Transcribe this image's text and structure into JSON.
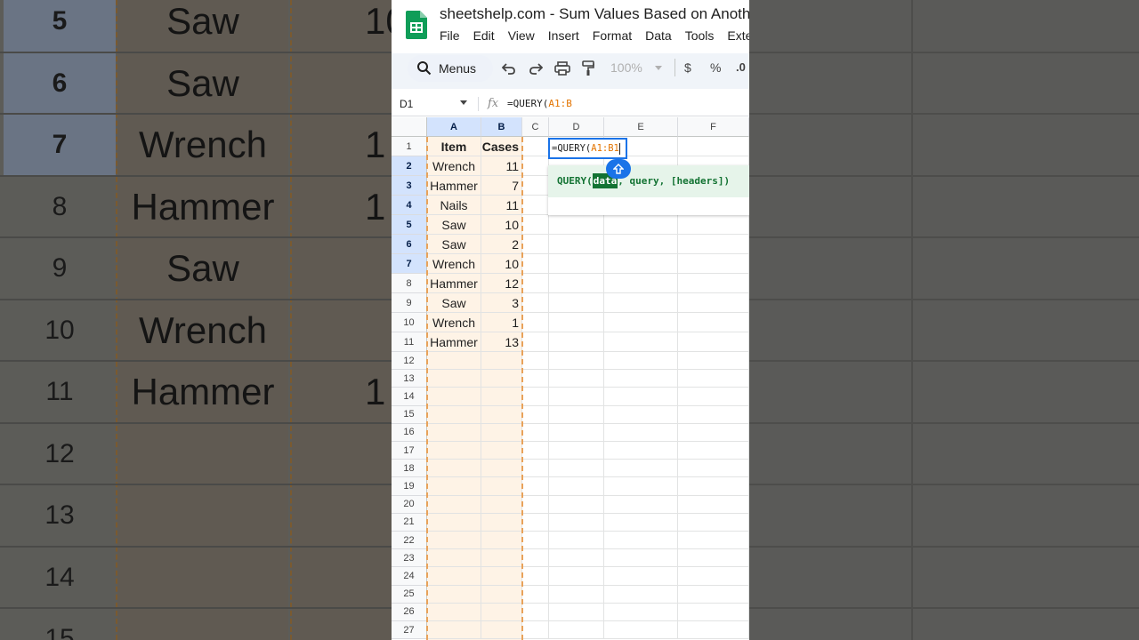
{
  "background": {
    "rows": [
      {
        "num": "5",
        "item": "Saw",
        "cases": "10",
        "selected": true
      },
      {
        "num": "6",
        "item": "Saw",
        "cases": "",
        "selected": true
      },
      {
        "num": "7",
        "item": "Wrench",
        "cases": "1",
        "selected": true
      },
      {
        "num": "8",
        "item": "Hammer",
        "cases": "1",
        "selected": false
      },
      {
        "num": "9",
        "item": "Saw",
        "cases": "",
        "selected": false
      },
      {
        "num": "10",
        "item": "Wrench",
        "cases": "",
        "selected": false
      },
      {
        "num": "11",
        "item": "Hammer",
        "cases": "1",
        "selected": false
      },
      {
        "num": "12",
        "item": "",
        "cases": "",
        "selected": false
      },
      {
        "num": "13",
        "item": "",
        "cases": "",
        "selected": false
      },
      {
        "num": "14",
        "item": "",
        "cases": "",
        "selected": false
      },
      {
        "num": "15",
        "item": "",
        "cases": "",
        "selected": false
      }
    ]
  },
  "app": {
    "doc_title": "sheetshelp.com - Sum Values Based on Anoth",
    "menu": [
      "File",
      "Edit",
      "View",
      "Insert",
      "Format",
      "Data",
      "Tools",
      "Exte"
    ]
  },
  "toolbar": {
    "menus_label": "Menus",
    "zoom": "100%",
    "currency": "$",
    "percent": "%",
    "decimal": ".0"
  },
  "formula_bar": {
    "name_box": "D1",
    "fx": "fx",
    "formula_prefix": "=QUERY(",
    "formula_range": "A1:B"
  },
  "sheet": {
    "columns": [
      "A",
      "B",
      "C",
      "D",
      "E",
      "F"
    ],
    "selected_columns": [
      "A",
      "B"
    ],
    "rows": [
      {
        "num": "1",
        "a": "Item",
        "b": "Cases",
        "selected": false
      },
      {
        "num": "2",
        "a": "Wrench",
        "b": "11",
        "selected": true
      },
      {
        "num": "3",
        "a": "Hammer",
        "b": "7",
        "selected": true
      },
      {
        "num": "4",
        "a": "Nails",
        "b": "11",
        "selected": true
      },
      {
        "num": "5",
        "a": "Saw",
        "b": "10",
        "selected": true
      },
      {
        "num": "6",
        "a": "Saw",
        "b": "2",
        "selected": true
      },
      {
        "num": "7",
        "a": "Wrench",
        "b": "10",
        "selected": true
      },
      {
        "num": "8",
        "a": "Hammer",
        "b": "12",
        "selected": false
      },
      {
        "num": "9",
        "a": "Saw",
        "b": "3",
        "selected": false
      },
      {
        "num": "10",
        "a": "Wrench",
        "b": "1",
        "selected": false
      },
      {
        "num": "11",
        "a": "Hammer",
        "b": "13",
        "selected": false
      },
      {
        "num": "12",
        "a": "",
        "b": "",
        "selected": false
      },
      {
        "num": "13",
        "a": "",
        "b": "",
        "selected": false
      },
      {
        "num": "14",
        "a": "",
        "b": "",
        "selected": false
      },
      {
        "num": "15",
        "a": "",
        "b": "",
        "selected": false
      },
      {
        "num": "16",
        "a": "",
        "b": "",
        "selected": false
      },
      {
        "num": "17",
        "a": "",
        "b": "",
        "selected": false
      },
      {
        "num": "18",
        "a": "",
        "b": "",
        "selected": false
      },
      {
        "num": "19",
        "a": "",
        "b": "",
        "selected": false
      },
      {
        "num": "20",
        "a": "",
        "b": "",
        "selected": false
      },
      {
        "num": "21",
        "a": "",
        "b": "",
        "selected": false
      },
      {
        "num": "22",
        "a": "",
        "b": "",
        "selected": false
      },
      {
        "num": "23",
        "a": "",
        "b": "",
        "selected": false
      },
      {
        "num": "24",
        "a": "",
        "b": "",
        "selected": false
      },
      {
        "num": "25",
        "a": "",
        "b": "",
        "selected": false
      },
      {
        "num": "26",
        "a": "",
        "b": "",
        "selected": false
      },
      {
        "num": "27",
        "a": "",
        "b": "",
        "selected": false
      }
    ]
  },
  "editor": {
    "prefix": "=QUERY(",
    "range": "A1:B1"
  },
  "hint": {
    "fn": "QUERY(",
    "arg_active": "data",
    "rest": ", query, [headers])"
  },
  "colors": {
    "accent": "#1a73e8",
    "range_orange": "#e37400",
    "hint_green": "#137333",
    "selected_header": "#d3e3fd"
  }
}
